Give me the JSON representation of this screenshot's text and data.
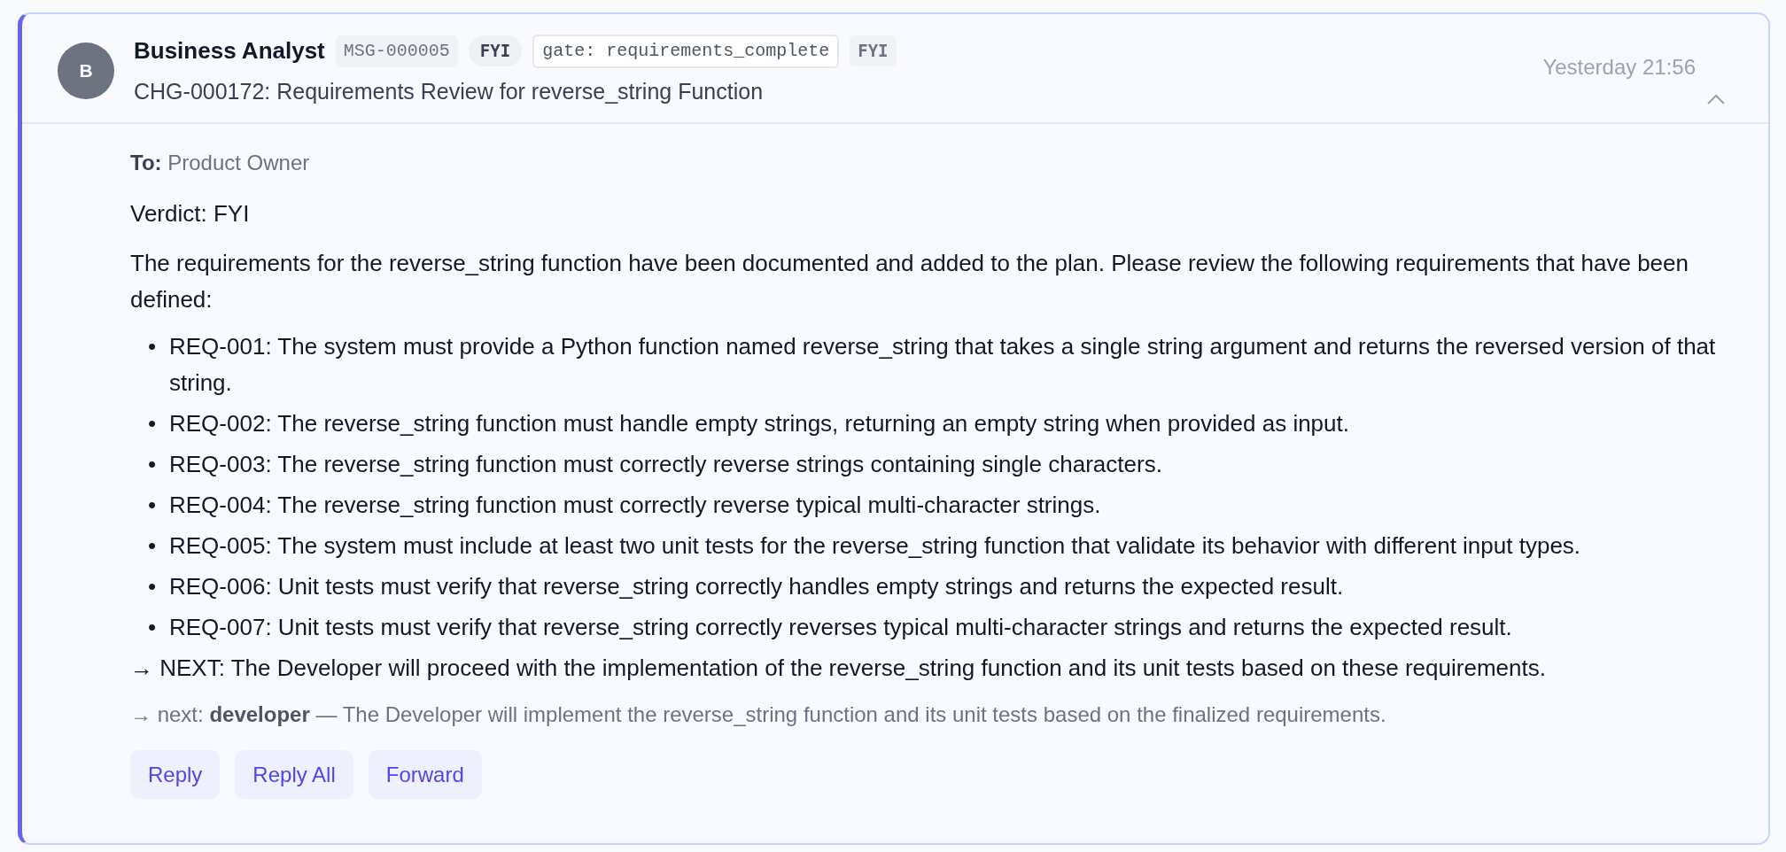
{
  "message": {
    "avatar": "B",
    "sender": "Business Analyst",
    "tags": [
      {
        "kind": "id",
        "text": "MSG-000005"
      },
      {
        "kind": "verdict",
        "text": "FYI"
      },
      {
        "kind": "gate",
        "text": "gate: requirements_complete"
      },
      {
        "kind": "plain",
        "text": "FYI"
      }
    ],
    "subject": "CHG-000172: Requirements Review for reverse_string Function",
    "time": "Yesterday 21:56",
    "expanded": true,
    "to_label": "To:",
    "to": "Product Owner",
    "verdict": "Verdict: FYI",
    "intro": "The requirements for the reverse_string function have been documented and added to the plan. Please review the following requirements that have been defined:",
    "bullet": "•",
    "requirements": [
      "REQ-001: The system must provide a Python function named reverse_string that takes a single string argument and returns the reversed version of that string.",
      "REQ-002: The reverse_string function must handle empty strings, returning an empty string when provided as input.",
      "REQ-003: The reverse_string function must correctly reverse strings containing single characters.",
      "REQ-004: The reverse_string function must correctly reverse typical multi-character strings.",
      "REQ-005: The system must include at least two unit tests for the reverse_string function that validate its behavior with different input types.",
      "REQ-006: Unit tests must verify that reverse_string correctly handles empty strings and returns the expected result.",
      "REQ-007: Unit tests must verify that reverse_string correctly reverses typical multi-character strings and returns the expected result."
    ],
    "next_step": "→ NEXT: The Developer will proceed with the implementation of the reverse_string function and its unit tests based on these requirements.",
    "handoff": "→ next: **developer** — The Developer will implement the reverse_string function and its unit tests based on the finalized requirements.",
    "buttons": [
      "Reply",
      "Reply All",
      "Forward"
    ]
  }
}
